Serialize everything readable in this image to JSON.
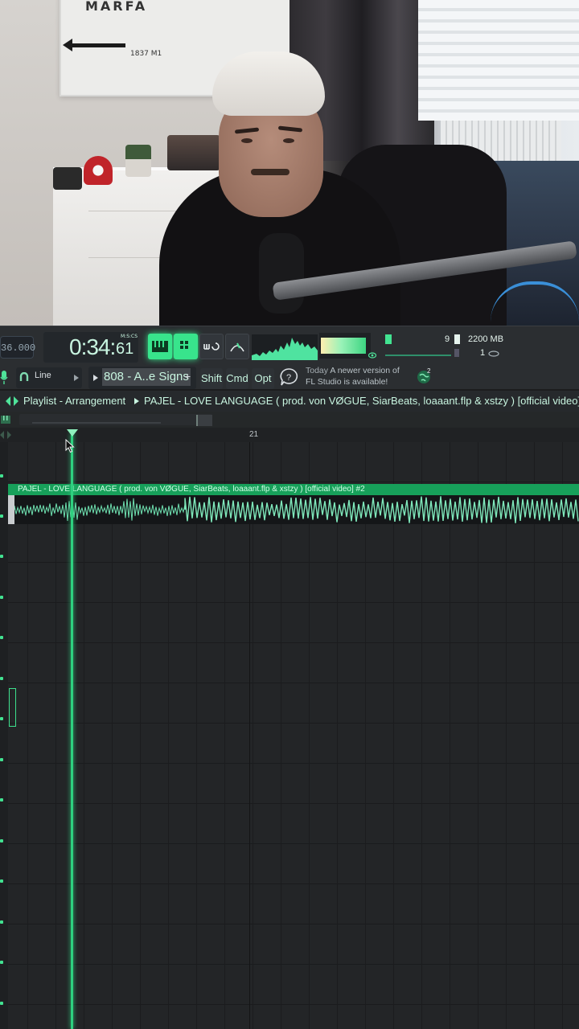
{
  "webcam": {
    "poster_text": "MARFA",
    "poster_small": "1837 M1"
  },
  "toolbar": {
    "tempo": "36.000",
    "time": {
      "main": "0:34:",
      "centis": "61",
      "tag": "M:S:CS"
    },
    "cpu": {
      "value": "9",
      "memory": "2200 MB",
      "polyphony": "1"
    }
  },
  "toolbar2": {
    "snap": "Line",
    "pattern": "808 - A..e Signs",
    "plus": "+",
    "buttons": [
      "Shift",
      "Cmd",
      "Opt"
    ],
    "news_day": "Today",
    "news_text": "A newer version of FL Studio is available!",
    "globe_badge": "2"
  },
  "playlist": {
    "title": "Playlist - Arrangement",
    "project": "PAJEL - LOVE LANGUAGE ( prod. von VØGUE, SiarBeats, loaaant.flp & xstzy ) [official video]",
    "timeline_marker": "21",
    "clip_name": "PAJEL - LOVE LANGUAGE ( prod. von VØGUE, SiarBeats, loaaant.flp & xstzy ) [official video] #2"
  },
  "colors": {
    "accent": "#38e48c",
    "clip_header": "#17a05a",
    "background": "#232527"
  }
}
